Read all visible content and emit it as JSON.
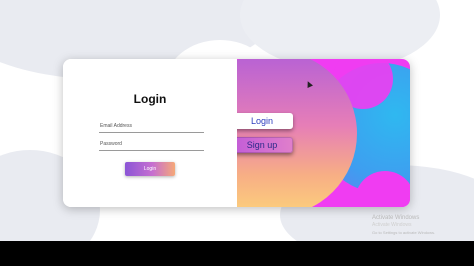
{
  "login_panel": {
    "title": "Login",
    "email_placeholder": "Email Address",
    "password_placeholder": "Password",
    "login_button": "Login"
  },
  "side_panel": {
    "login_button": "Login",
    "signup_button": "Sign up"
  },
  "watermark": {
    "title": "Activate Windows",
    "subtitle": "Go to Settings to activate Windows."
  },
  "colors": {
    "accent_pink": "#f03cf2",
    "accent_blue": "#3e9ef0",
    "button_text_blue": "#2b3cbf"
  }
}
